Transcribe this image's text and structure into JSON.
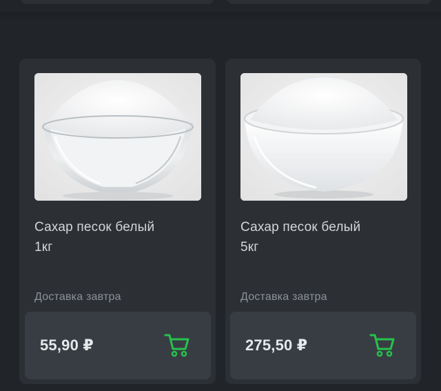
{
  "products": [
    {
      "title_line1": "Сахар песок белый",
      "title_line2": "1кг",
      "delivery": "Доставка завтра",
      "price": "55,90 ₽",
      "image": "sugar-glass-bowl",
      "cart_icon": "cart-icon"
    },
    {
      "title_line1": "Сахар песок белый",
      "title_line2": "5кг",
      "delivery": "Доставка завтра",
      "price": "275,50 ₽",
      "image": "sugar-white-bowl",
      "cart_icon": "cart-icon"
    }
  ],
  "colors": {
    "background": "#212529",
    "card": "#2c3035",
    "buy_bar": "#383d44",
    "cart_accent": "#27c24c"
  }
}
